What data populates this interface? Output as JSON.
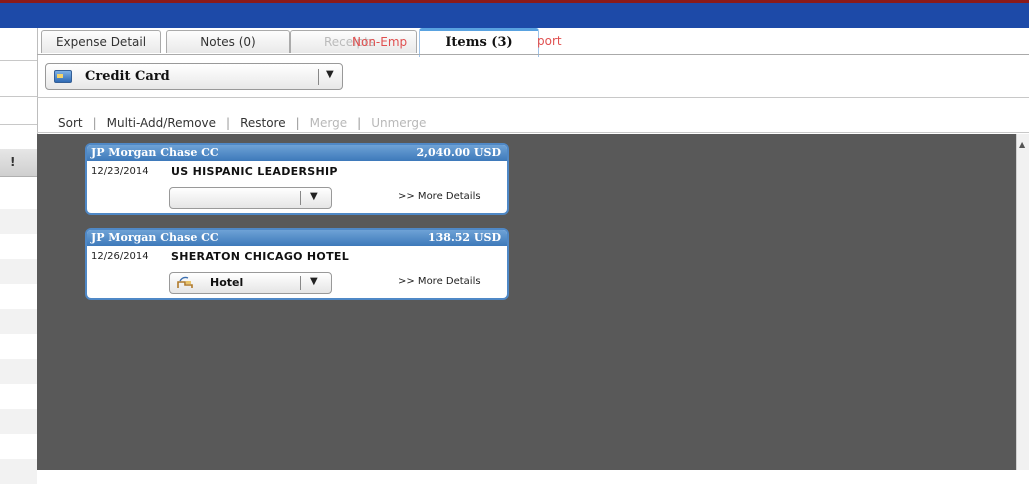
{
  "tabs": {
    "expense_detail": "Expense Detail",
    "notes": "Notes (0)",
    "receipts_partial": "Receipts",
    "non_emp_partial": "Non-Emp",
    "items": "Items (3)",
    "report_partial": "port"
  },
  "payment_type": {
    "selected": "Credit Card",
    "icon": "credit-card-icon"
  },
  "toolbar": {
    "sort": "Sort",
    "multi_add_remove": "Multi-Add/Remove",
    "restore": "Restore",
    "merge": "Merge",
    "unmerge": "Unmerge"
  },
  "left_column": {
    "header": "!"
  },
  "items": [
    {
      "issuer": "JP Morgan Chase CC",
      "amount": "2,040.00 USD",
      "date": "12/23/2014",
      "vendor": "US HISPANIC LEADERSHIP",
      "expense_type": "",
      "more_details": ">> More Details"
    },
    {
      "issuer": "JP Morgan Chase CC",
      "amount": "138.52 USD",
      "date": "12/26/2014",
      "vendor": "SHERATON CHICAGO HOTEL",
      "expense_type": "Hotel",
      "expense_icon": "hotel-icon",
      "more_details": ">> More Details"
    }
  ],
  "colors": {
    "top_bar": "#1d4aa8",
    "card_header": "#4f88c6",
    "pane_background": "#595959",
    "active_tab_accent": "#59a2e0"
  }
}
